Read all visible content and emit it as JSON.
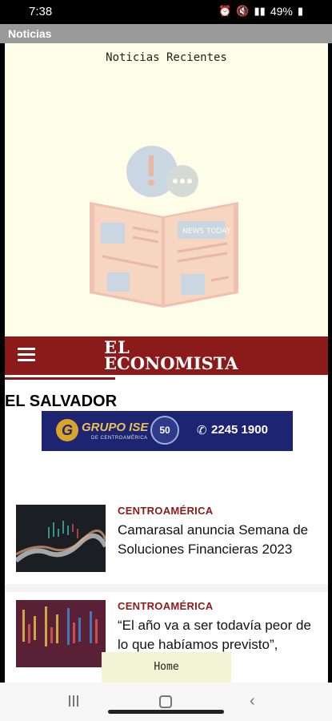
{
  "status_bar": {
    "time": "7:38",
    "battery": "49%",
    "icons": [
      "alarm-icon",
      "mute-icon",
      "volte-icon",
      "signal-icon",
      "battery-icon"
    ]
  },
  "app_bar": {
    "title": "Noticias"
  },
  "hero": {
    "title": "Noticias Recientes",
    "illustration": "newspaper-reader-illustration",
    "illustration_text": "NEWS TODAY"
  },
  "site_header": {
    "logo_line1": "EL",
    "logo_line2": "ECONOMISTA",
    "menu_icon": "hamburger-icon",
    "accent_color": "#8b1a1a"
  },
  "section": {
    "title": "EL SALVADOR"
  },
  "ad": {
    "brand": "GRUPO ISE",
    "brand_sub": "DE CENTROAMÉRICA",
    "badge": "50",
    "phone": "2245 1900",
    "background_color": "#1d2573"
  },
  "articles": [
    {
      "category": "CENTROAMÉRICA",
      "title": "Camarasal anuncia Semana de Soluciones Financieras 2023"
    },
    {
      "category": "CENTROAMÉRICA",
      "title": "“El año va a ser todavía peor de lo que habíamos previsto”,"
    }
  ],
  "home_button": {
    "label": "Home"
  },
  "nav_bar": {
    "icons": [
      "recents-icon",
      "home-icon",
      "back-icon"
    ]
  }
}
